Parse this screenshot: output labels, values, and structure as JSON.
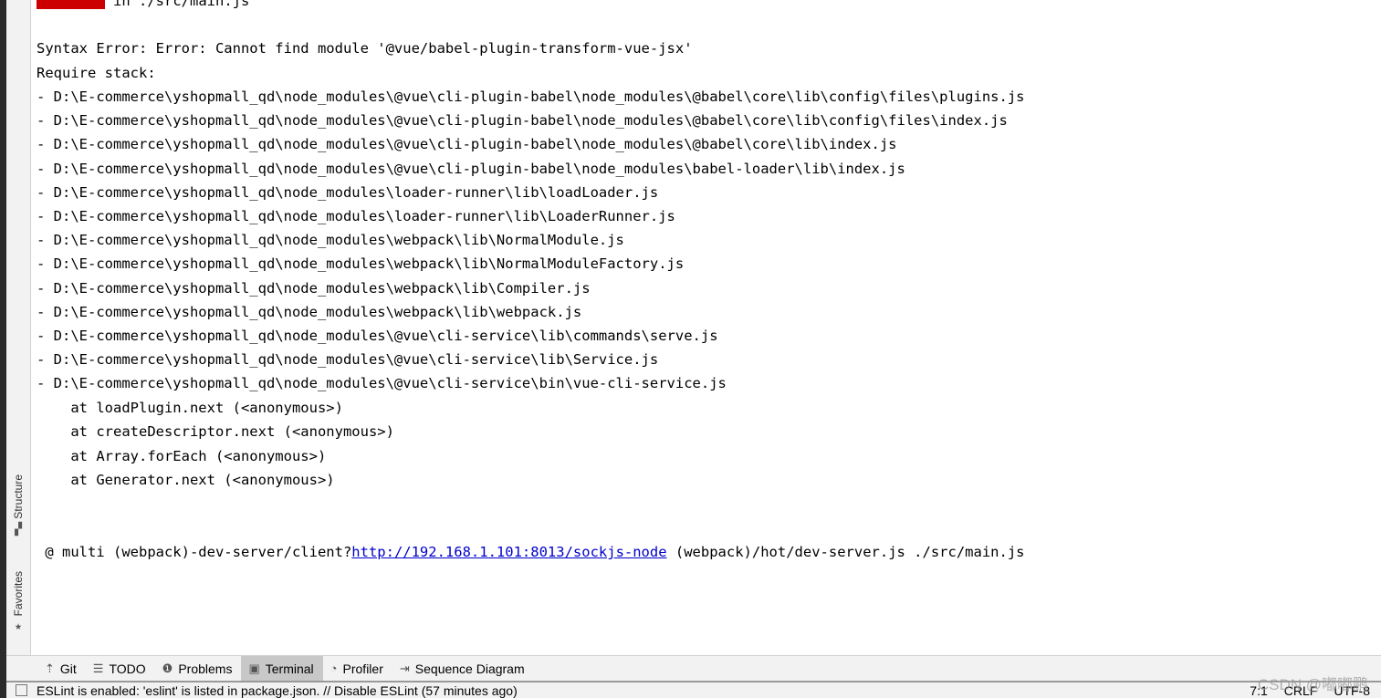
{
  "console": {
    "header": {
      "badge": "error",
      "text": " in ./src/main.js"
    },
    "error_line": "Syntax Error: Error: Cannot find module '@vue/babel-plugin-transform-vue-jsx'",
    "require_label": "Require stack:",
    "stack": [
      "- D:\\E-commerce\\yshopmall_qd\\node_modules\\@vue\\cli-plugin-babel\\node_modules\\@babel\\core\\lib\\config\\files\\plugins.js",
      "- D:\\E-commerce\\yshopmall_qd\\node_modules\\@vue\\cli-plugin-babel\\node_modules\\@babel\\core\\lib\\config\\files\\index.js",
      "- D:\\E-commerce\\yshopmall_qd\\node_modules\\@vue\\cli-plugin-babel\\node_modules\\@babel\\core\\lib\\index.js",
      "- D:\\E-commerce\\yshopmall_qd\\node_modules\\@vue\\cli-plugin-babel\\node_modules\\babel-loader\\lib\\index.js",
      "- D:\\E-commerce\\yshopmall_qd\\node_modules\\loader-runner\\lib\\loadLoader.js",
      "- D:\\E-commerce\\yshopmall_qd\\node_modules\\loader-runner\\lib\\LoaderRunner.js",
      "- D:\\E-commerce\\yshopmall_qd\\node_modules\\webpack\\lib\\NormalModule.js",
      "- D:\\E-commerce\\yshopmall_qd\\node_modules\\webpack\\lib\\NormalModuleFactory.js",
      "- D:\\E-commerce\\yshopmall_qd\\node_modules\\webpack\\lib\\Compiler.js",
      "- D:\\E-commerce\\yshopmall_qd\\node_modules\\webpack\\lib\\webpack.js",
      "- D:\\E-commerce\\yshopmall_qd\\node_modules\\@vue\\cli-service\\lib\\commands\\serve.js",
      "- D:\\E-commerce\\yshopmall_qd\\node_modules\\@vue\\cli-service\\lib\\Service.js",
      "- D:\\E-commerce\\yshopmall_qd\\node_modules\\@vue\\cli-service\\bin\\vue-cli-service.js"
    ],
    "at_lines": [
      "    at loadPlugin.next (<anonymous>)",
      "    at createDescriptor.next (<anonymous>)",
      "    at Array.forEach (<anonymous>)",
      "    at Generator.next (<anonymous>)"
    ],
    "multi": {
      "prefix": " @ multi (webpack)-dev-server/client?",
      "link": "http://192.168.1.101:8013/sockjs-node",
      "suffix": " (webpack)/hot/dev-server.js ./src/main.js"
    }
  },
  "side_tabs": {
    "structure": "Structure",
    "favorites": "Favorites"
  },
  "toolbar": [
    {
      "label": "Git",
      "icon": "git-icon",
      "glyph": "⇡"
    },
    {
      "label": "TODO",
      "icon": "todo-icon",
      "glyph": "☰"
    },
    {
      "label": "Problems",
      "icon": "problems-icon",
      "glyph": "❶"
    },
    {
      "label": "Terminal",
      "icon": "terminal-icon",
      "glyph": "▣",
      "active": true
    },
    {
      "label": "Profiler",
      "icon": "profiler-icon",
      "glyph": "◔"
    },
    {
      "label": "Sequence Diagram",
      "icon": "sequence-diagram-icon",
      "glyph": "⇥"
    }
  ],
  "status": {
    "message": "ESLint is enabled: 'eslint' is listed in package.json. // Disable ESLint (57 minutes ago)",
    "position": "7:1",
    "line_ending": "CRLF",
    "encoding": "UTF-8"
  },
  "watermark": "CSDN @嘟嘟鹏",
  "colors": {
    "error_badge": "#cc0000",
    "link": "#0000cc"
  }
}
